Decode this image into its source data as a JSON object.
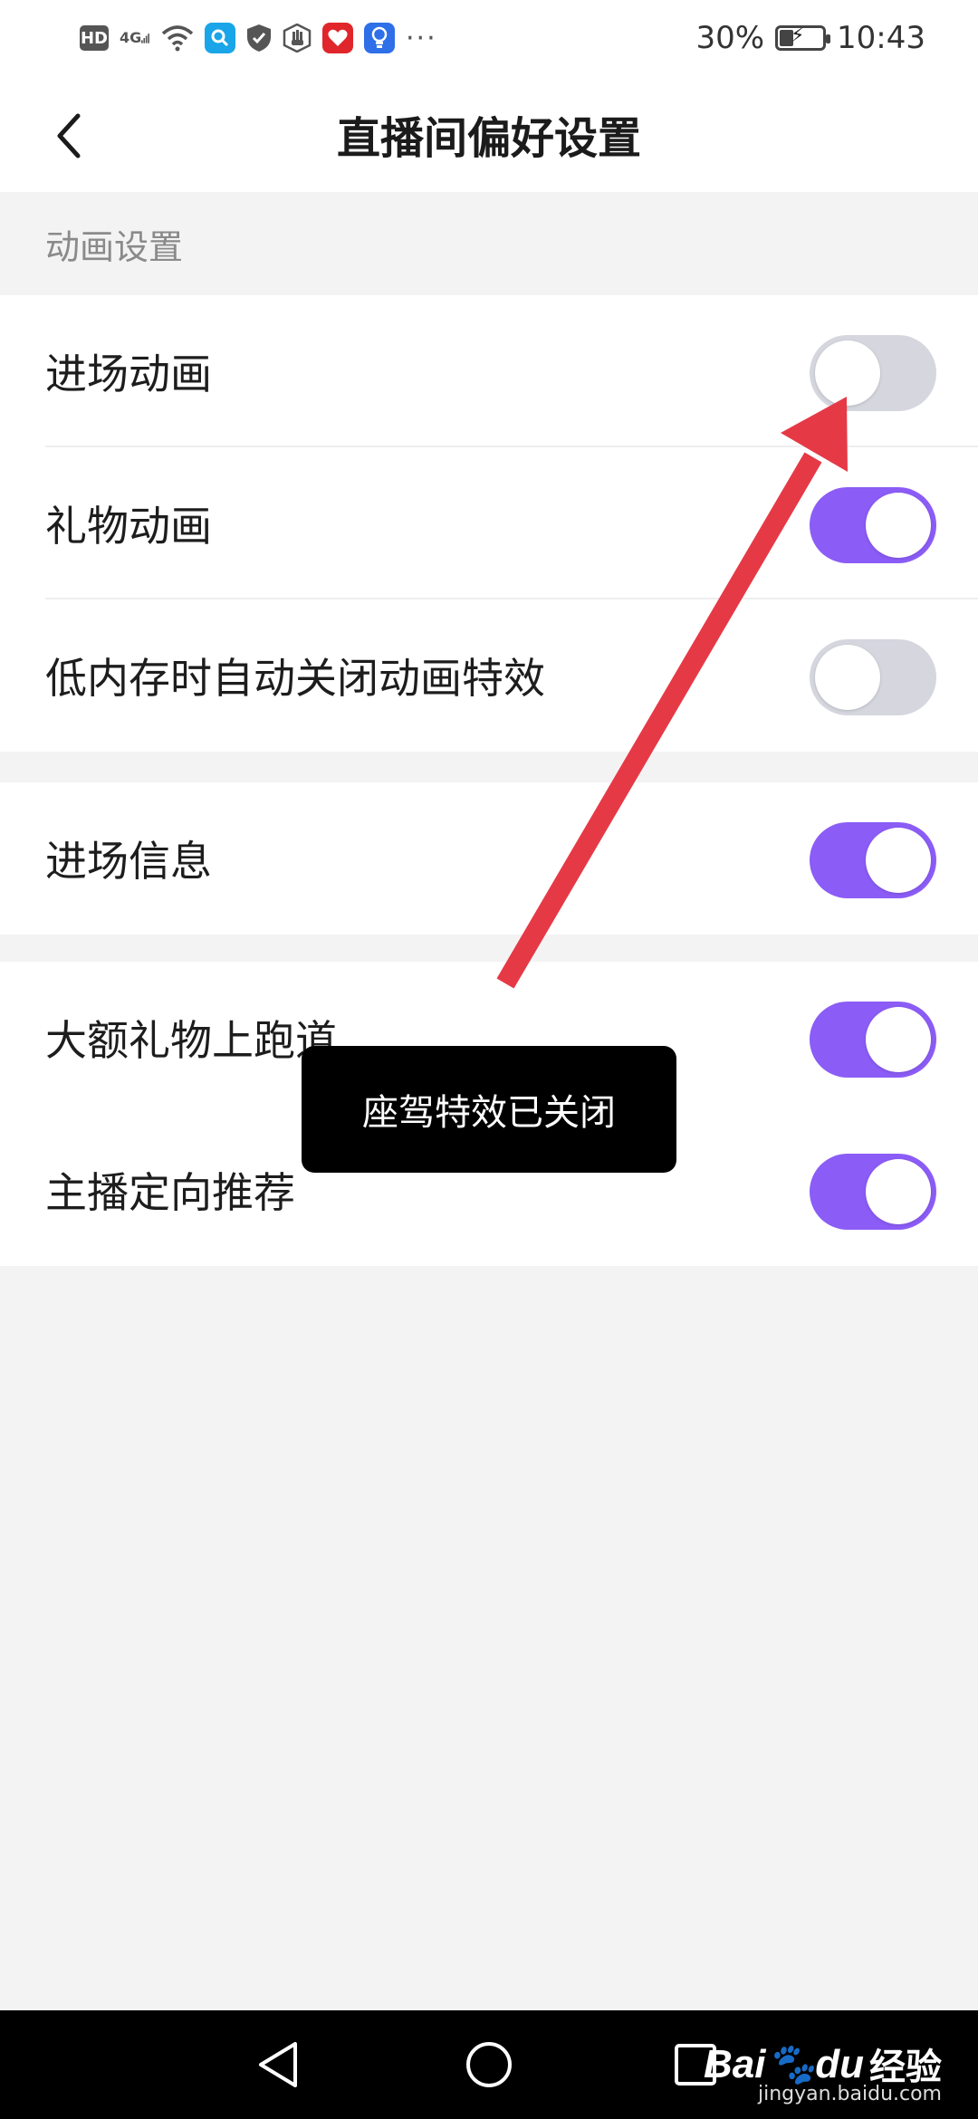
{
  "status_bar": {
    "hd": "HD",
    "network": "4G",
    "battery_percent_label": "30%",
    "battery_level": 0.3,
    "time": "10:43",
    "more": "···",
    "icons": [
      "hd-icon",
      "signal-icon",
      "wifi-icon",
      "search-app-icon",
      "shield-icon",
      "hand-icon",
      "heart-app-icon",
      "bulb-app-icon",
      "more-icon",
      "battery-icon"
    ]
  },
  "header": {
    "title": "直播间偏好设置",
    "back_icon": "chevron-left-icon"
  },
  "sections": {
    "animation": {
      "title": "动画设置",
      "items": [
        {
          "label": "进场动画",
          "enabled": false
        },
        {
          "label": "礼物动画",
          "enabled": true
        },
        {
          "label": "低内存时自动关闭动画特效",
          "enabled": false
        }
      ]
    },
    "entry_info": {
      "items": [
        {
          "label": "进场信息",
          "enabled": true
        }
      ]
    },
    "other": {
      "items": [
        {
          "label": "大额礼物上跑道",
          "enabled": true
        },
        {
          "label": "主播定向推荐",
          "enabled": true
        }
      ]
    }
  },
  "toast": {
    "text": "座驾特效已关闭"
  },
  "annotation": {
    "arrow_color": "#e63946"
  },
  "colors": {
    "toggle_on": "#8b5cf6",
    "toggle_off": "#d5d6de",
    "background": "#f3f3f4"
  },
  "nav_bar": {
    "back_icon": "triangle-back-icon",
    "home_icon": "circle-home-icon",
    "recents_icon": "square-recents-icon"
  },
  "watermark": {
    "logo": "Bai",
    "logo_suffix": "du",
    "text": "经验",
    "url": "jingyan.baidu.com"
  }
}
